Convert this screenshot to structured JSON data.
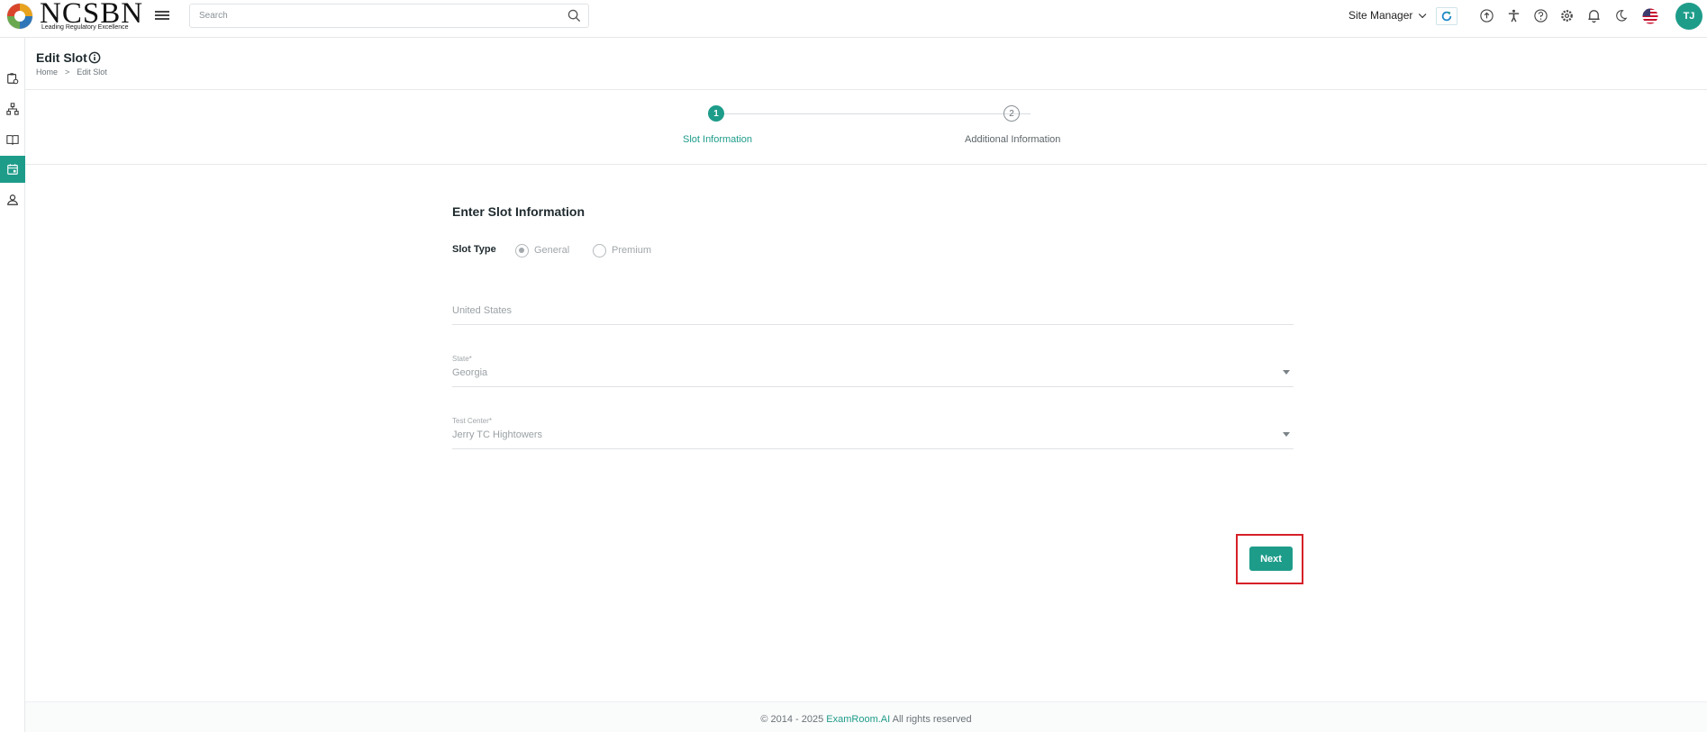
{
  "header": {
    "logo_text": "NCSBN",
    "logo_tagline": "Leading Regulatory Excellence",
    "search_placeholder": "Search",
    "role": "Site Manager",
    "avatar_initials": "TJ",
    "icons": [
      "menu-icon",
      "search-icon",
      "refresh-icon",
      "add-circle-icon",
      "accessibility-icon",
      "help-icon",
      "settings-icon",
      "bell-icon",
      "moon-icon",
      "us-flag-icon"
    ]
  },
  "sidebar": {
    "items": [
      {
        "icon": "clipboard-settings-icon",
        "active": false
      },
      {
        "icon": "sitemap-icon",
        "active": false
      },
      {
        "icon": "book-icon",
        "active": false
      },
      {
        "icon": "calendar-icon",
        "active": true
      },
      {
        "icon": "user-icon",
        "active": false
      }
    ]
  },
  "page": {
    "title": "Edit Slot",
    "breadcrumb": {
      "home": "Home",
      "separator": ">",
      "current": "Edit Slot"
    }
  },
  "stepper": {
    "steps": [
      {
        "number": "1",
        "label": "Slot Information",
        "active": true
      },
      {
        "number": "2",
        "label": "Additional Information",
        "active": false
      }
    ]
  },
  "form": {
    "title": "Enter Slot Information",
    "slot_type_label": "Slot Type",
    "slot_type_options": [
      {
        "label": "General",
        "checked": true
      },
      {
        "label": "Premium",
        "checked": false
      }
    ],
    "country_value": "United States",
    "state_label": "State*",
    "state_value": "Georgia",
    "test_center_label": "Test Center*",
    "test_center_value": "Jerry TC Hightowers",
    "next_label": "Next"
  },
  "footer": {
    "prefix": "© 2014 - 2025 ",
    "brand": "ExamRoom.AI",
    "suffix": " All rights reserved"
  },
  "colors": {
    "accent": "#1e9c8a",
    "highlight": "#d62027"
  }
}
